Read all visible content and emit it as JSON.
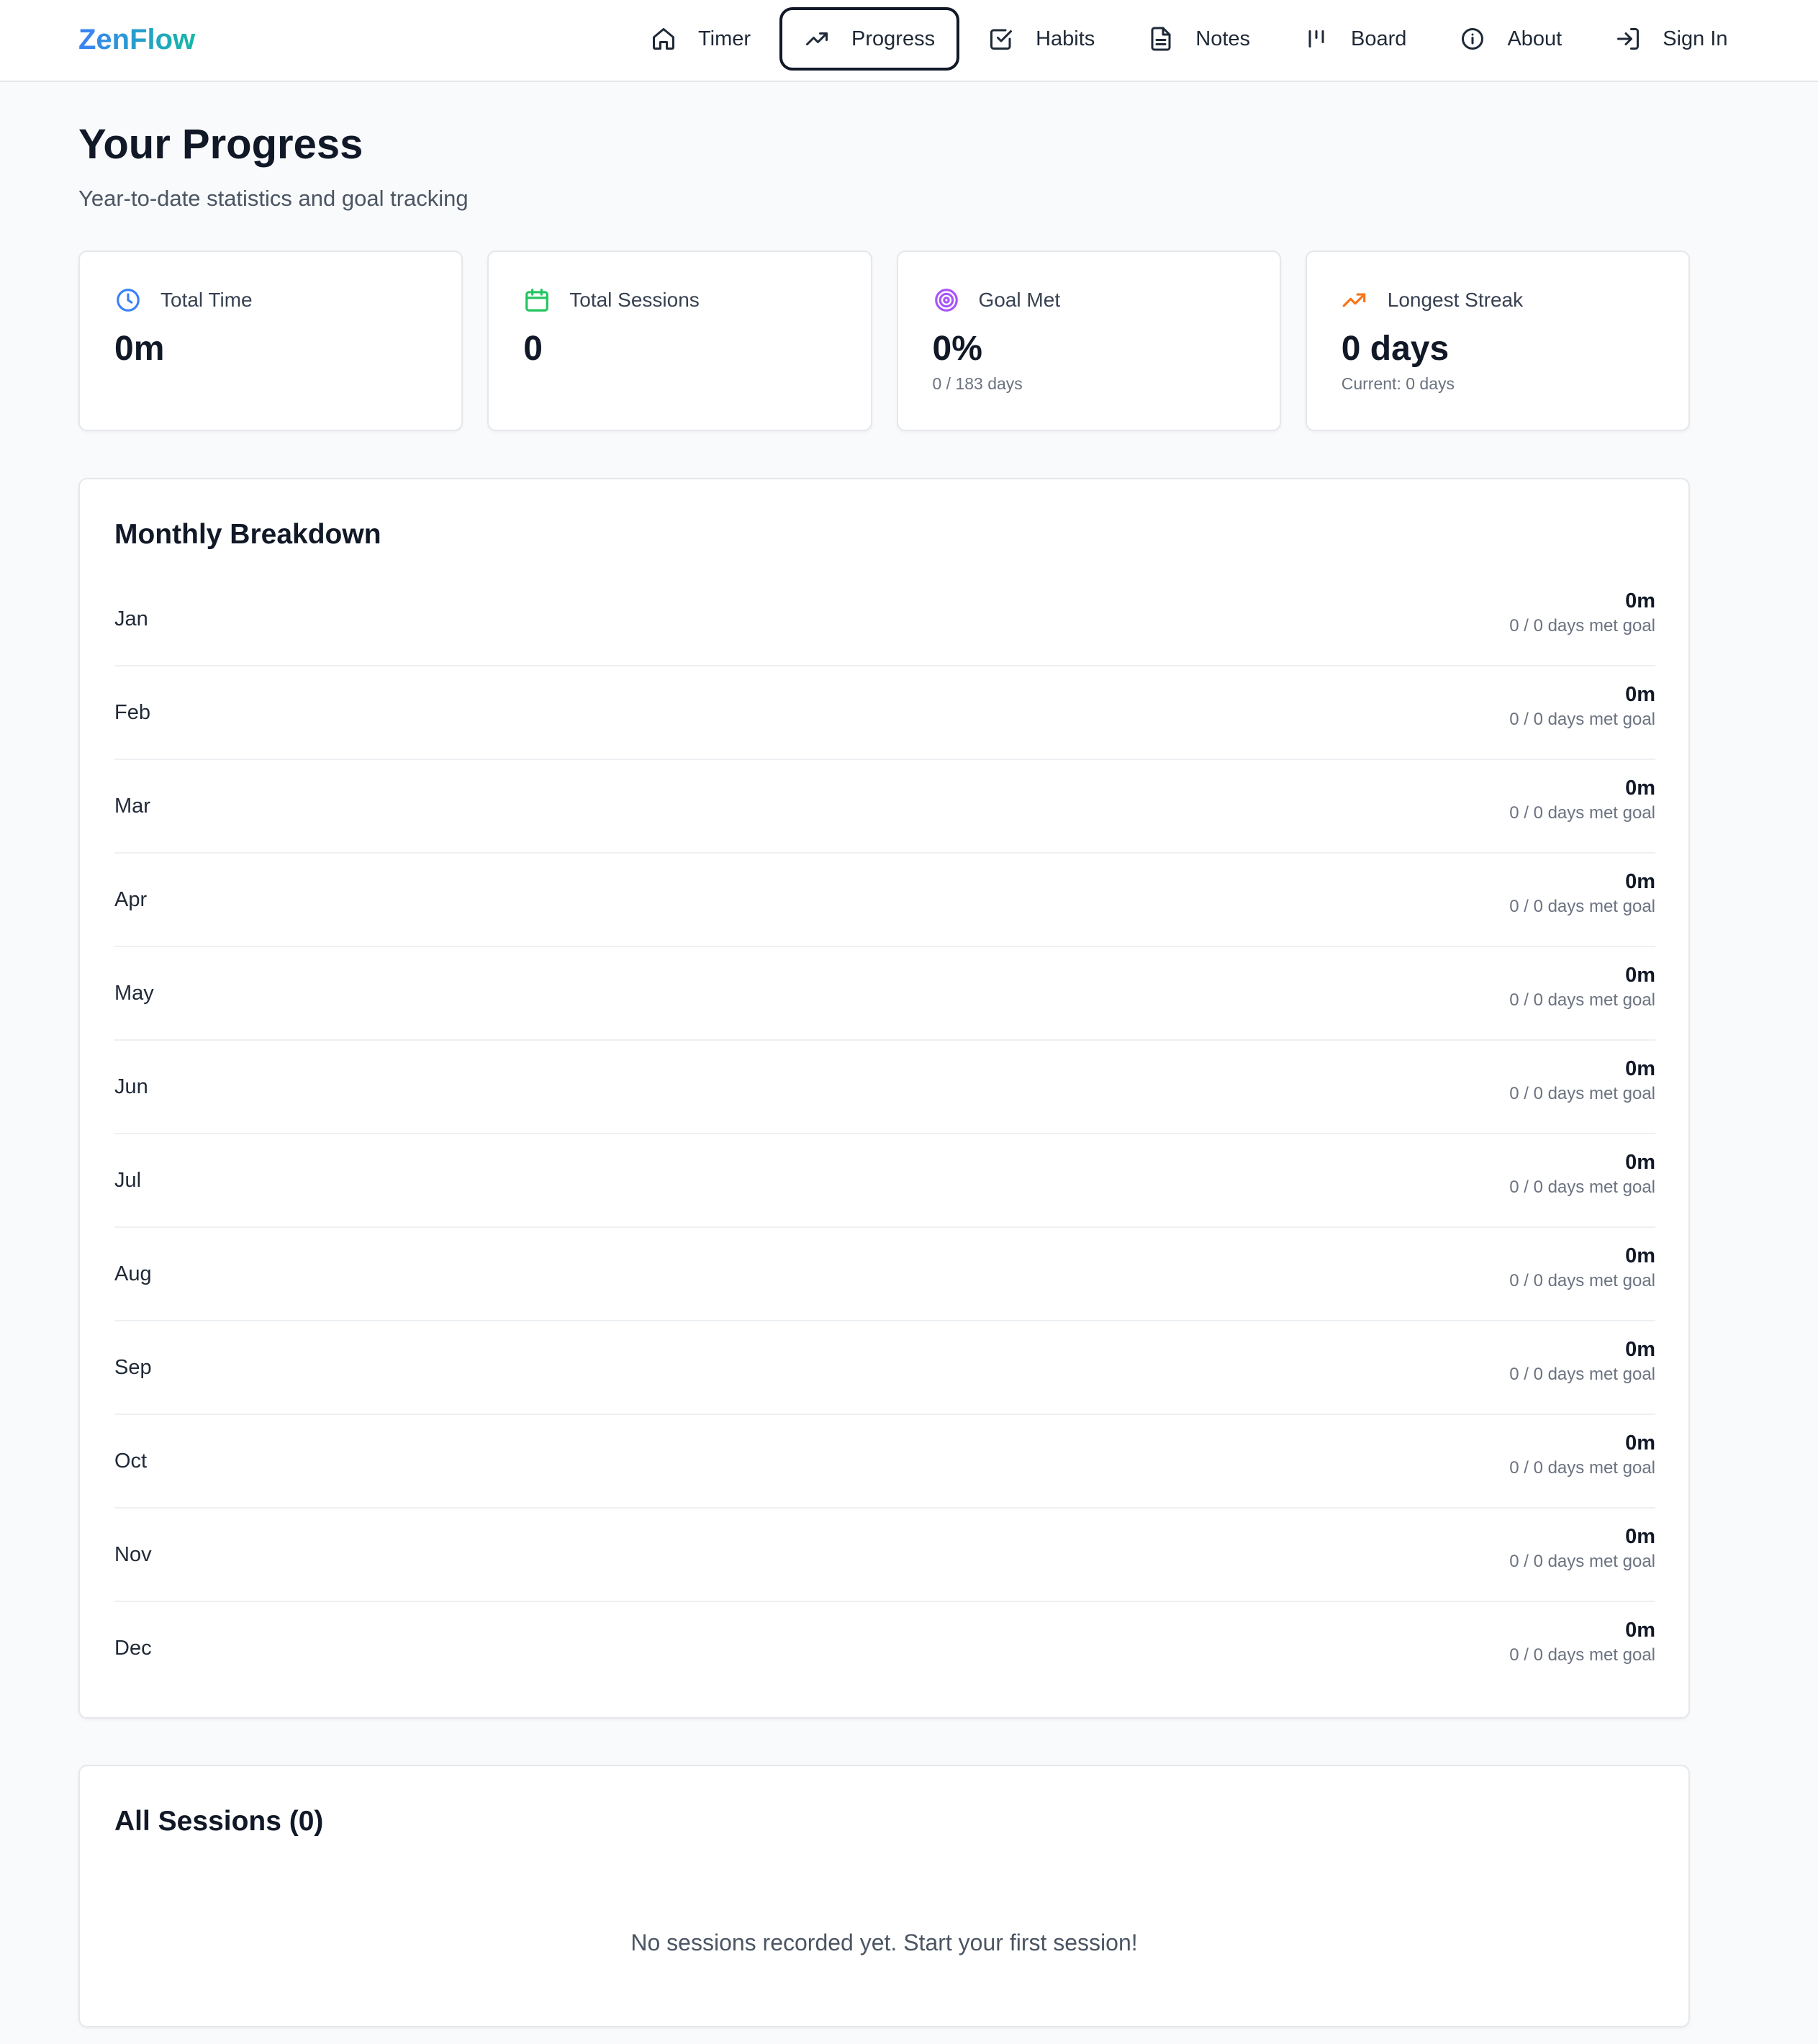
{
  "header": {
    "brand": "ZenFlow",
    "nav": [
      {
        "label": "Timer",
        "icon": "home-icon",
        "active": false
      },
      {
        "label": "Progress",
        "icon": "trending-up-icon",
        "active": true
      },
      {
        "label": "Habits",
        "icon": "check-square-icon",
        "active": false
      },
      {
        "label": "Notes",
        "icon": "file-text-icon",
        "active": false
      },
      {
        "label": "Board",
        "icon": "kanban-icon",
        "active": false
      },
      {
        "label": "About",
        "icon": "info-icon",
        "active": false
      },
      {
        "label": "Sign In",
        "icon": "sign-in-icon",
        "active": false
      }
    ]
  },
  "page": {
    "title": "Your Progress",
    "subtitle": "Year-to-date statistics and goal tracking"
  },
  "stats": [
    {
      "label": "Total Time",
      "value": "0m",
      "sub": "",
      "icon": "clock-icon",
      "color": "#3b82f6"
    },
    {
      "label": "Total Sessions",
      "value": "0",
      "sub": "",
      "icon": "calendar-icon",
      "color": "#22c55e"
    },
    {
      "label": "Goal Met",
      "value": "0%",
      "sub": "0 / 183 days",
      "icon": "target-icon",
      "color": "#a855f7"
    },
    {
      "label": "Longest Streak",
      "value": "0 days",
      "sub": "Current: 0 days",
      "icon": "trending-up-icon",
      "color": "#f97316"
    }
  ],
  "monthly": {
    "title": "Monthly Breakdown",
    "months": [
      {
        "name": "Jan",
        "time": "0m",
        "goal": "0 / 0 days met goal"
      },
      {
        "name": "Feb",
        "time": "0m",
        "goal": "0 / 0 days met goal"
      },
      {
        "name": "Mar",
        "time": "0m",
        "goal": "0 / 0 days met goal"
      },
      {
        "name": "Apr",
        "time": "0m",
        "goal": "0 / 0 days met goal"
      },
      {
        "name": "May",
        "time": "0m",
        "goal": "0 / 0 days met goal"
      },
      {
        "name": "Jun",
        "time": "0m",
        "goal": "0 / 0 days met goal"
      },
      {
        "name": "Jul",
        "time": "0m",
        "goal": "0 / 0 days met goal"
      },
      {
        "name": "Aug",
        "time": "0m",
        "goal": "0 / 0 days met goal"
      },
      {
        "name": "Sep",
        "time": "0m",
        "goal": "0 / 0 days met goal"
      },
      {
        "name": "Oct",
        "time": "0m",
        "goal": "0 / 0 days met goal"
      },
      {
        "name": "Nov",
        "time": "0m",
        "goal": "0 / 0 days met goal"
      },
      {
        "name": "Dec",
        "time": "0m",
        "goal": "0 / 0 days met goal"
      }
    ]
  },
  "sessions": {
    "title": "All Sessions (0)",
    "empty_message": "No sessions recorded yet. Start your first session!"
  }
}
